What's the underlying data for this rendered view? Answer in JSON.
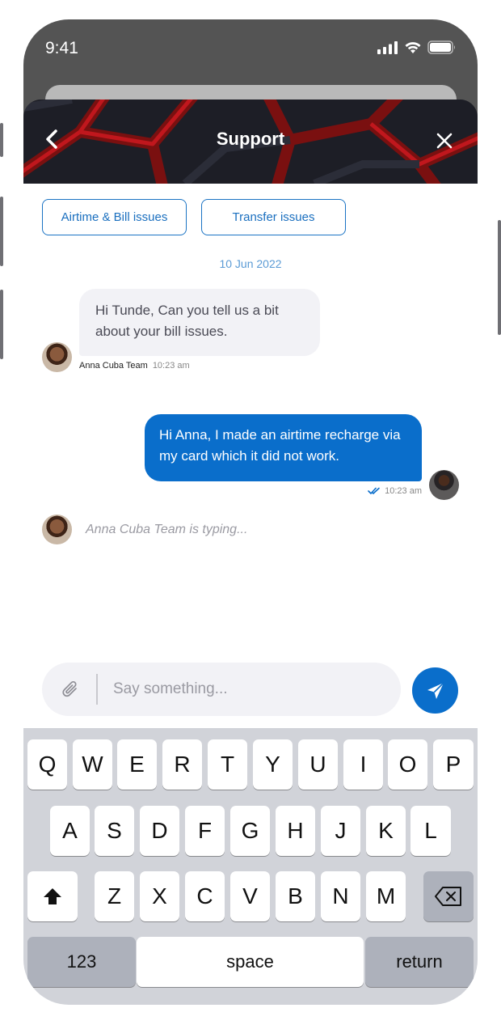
{
  "status_bar": {
    "time": "9:41"
  },
  "header": {
    "title": "Support"
  },
  "quick_replies": [
    "Airtime & Bill issues",
    "Transfer issues"
  ],
  "date_separator": "10 Jun 2022",
  "messages": [
    {
      "direction": "incoming",
      "text": "Hi Tunde, Can you tell us a bit about your bill issues.",
      "sender": "Anna Cuba Team",
      "time": "10:23 am"
    },
    {
      "direction": "outgoing",
      "text": "Hi Anna, I made an airtime recharge via my card which it did not work.",
      "time": "10:23 am",
      "status": "read"
    }
  ],
  "typing_indicator": "Anna Cuba Team is typing...",
  "composer": {
    "placeholder": "Say something..."
  },
  "keyboard": {
    "row1": [
      "Q",
      "W",
      "E",
      "R",
      "T",
      "Y",
      "U",
      "I",
      "O",
      "P"
    ],
    "row2": [
      "A",
      "S",
      "D",
      "F",
      "G",
      "H",
      "J",
      "K",
      "L"
    ],
    "row3": [
      "Z",
      "X",
      "C",
      "V",
      "B",
      "N",
      "M"
    ],
    "numbers_label": "123",
    "space_label": "space",
    "return_label": "return"
  },
  "colors": {
    "accent": "#0a6ecb",
    "bubble_in": "#f2f2f6",
    "keyboard_bg": "#d1d3d9"
  }
}
